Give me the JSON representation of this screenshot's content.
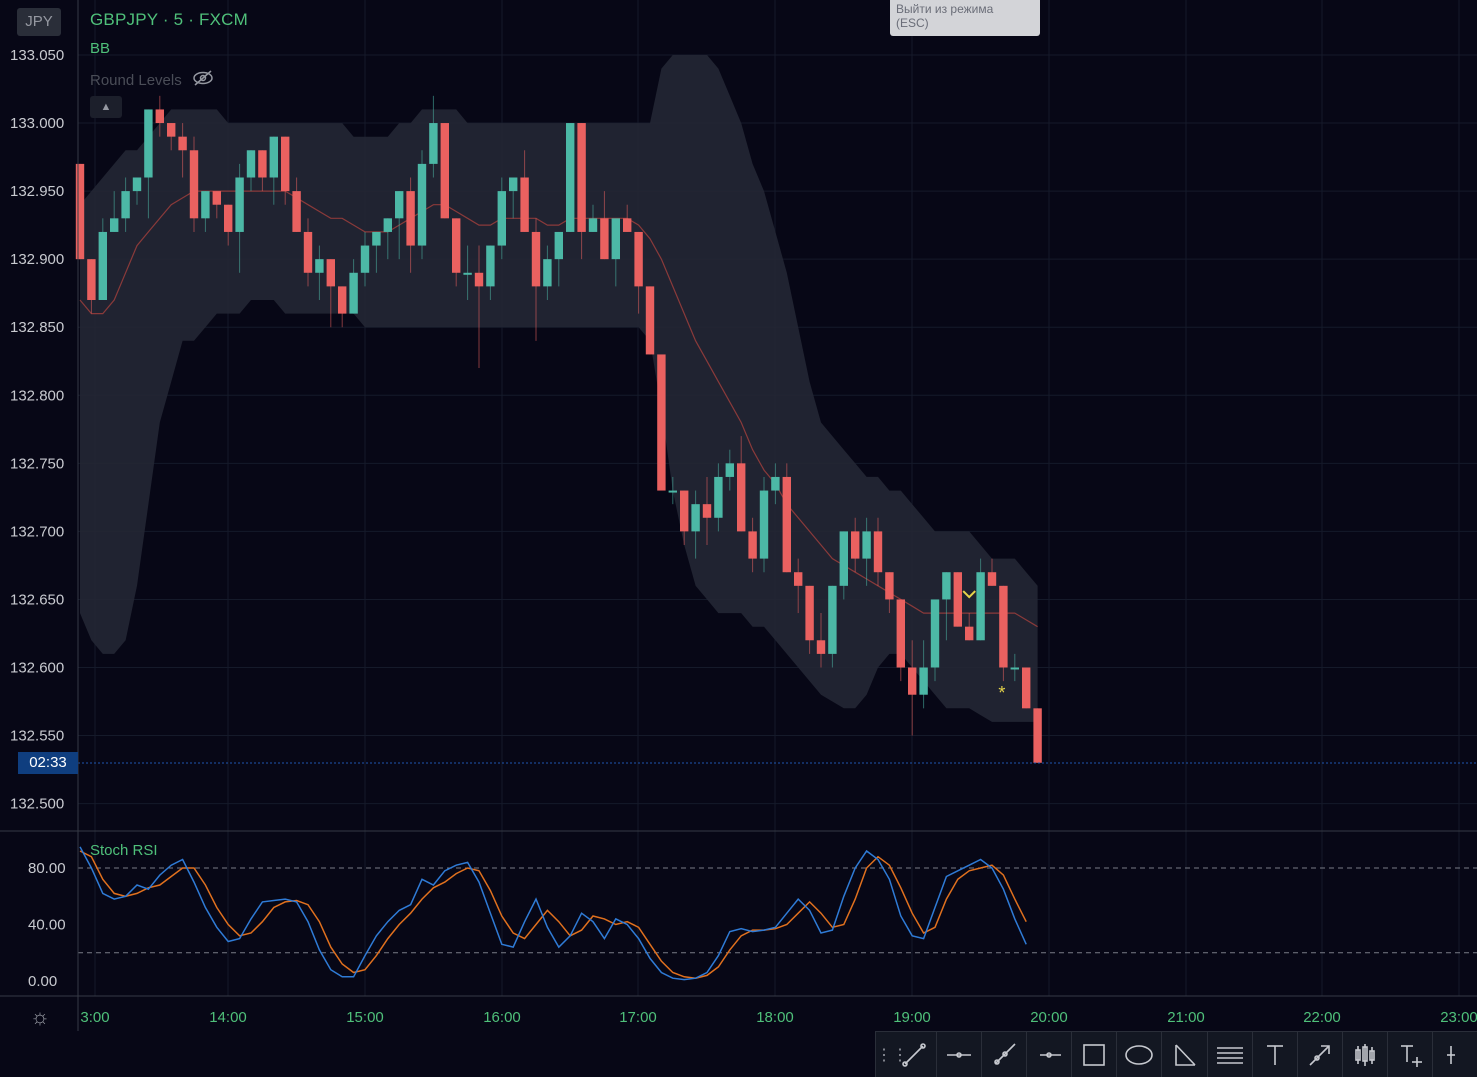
{
  "header": {
    "currency_badge": "JPY",
    "symbol_line": "GBPJPY · 5 · FXCM",
    "indicators": [
      "BB",
      "Round Levels"
    ],
    "hidden_indicator_icon": "eye-off-icon",
    "collapse_icon": "chevron-up-icon"
  },
  "tooltip": {
    "line1": "Выйти из режима",
    "line2": "(ESC)"
  },
  "countdown": "02:33",
  "price_axis": {
    "labels": [
      "133.050",
      "133.000",
      "132.950",
      "132.900",
      "132.850",
      "132.800",
      "132.750",
      "132.700",
      "132.650",
      "132.600",
      "132.550",
      "132.500"
    ]
  },
  "stoch_panel": {
    "title": "Stoch RSI",
    "axis_labels": [
      "80.00",
      "40.00",
      "0.00"
    ],
    "bands": [
      20,
      80
    ]
  },
  "time_axis": {
    "labels": [
      "3:00",
      "14:00",
      "15:00",
      "16:00",
      "17:00",
      "18:00",
      "19:00",
      "20:00",
      "21:00",
      "22:00",
      "23:00"
    ]
  },
  "colors": {
    "background": "#070716",
    "bull": "#4cb8a6",
    "bear": "#ea6160",
    "k_line": "#2f7bd6",
    "d_line": "#e0701e",
    "axis_text": "#4fc07a",
    "band_fill": "#232734"
  },
  "toolbar": {
    "icons": [
      "trend-line-icon",
      "horizontal-line-icon",
      "ray-icon",
      "horizontal-ray-icon",
      "rectangle-icon",
      "ellipse-icon",
      "angle-icon",
      "parallel-lines-icon",
      "text-icon",
      "arrow-icon",
      "candles-icon",
      "anchored-text-icon"
    ]
  },
  "chart_data": {
    "type": "candlestick",
    "symbol": "GBPJPY",
    "timeframe": "5",
    "source": "FXCM",
    "ylim": [
      132.48,
      133.08
    ],
    "candles": [
      [
        132.97,
        132.97,
        132.9,
        132.9
      ],
      [
        132.9,
        132.9,
        132.86,
        132.87
      ],
      [
        132.87,
        132.93,
        132.87,
        132.92
      ],
      [
        132.92,
        132.95,
        132.92,
        132.93
      ],
      [
        132.93,
        132.96,
        132.92,
        132.95
      ],
      [
        132.95,
        132.96,
        132.94,
        132.96
      ],
      [
        132.96,
        133.01,
        132.93,
        133.01
      ],
      [
        133.01,
        133.02,
        132.99,
        133.0
      ],
      [
        133.0,
        133.0,
        132.98,
        132.99
      ],
      [
        132.99,
        133.0,
        132.96,
        132.98
      ],
      [
        132.98,
        132.99,
        132.92,
        132.93
      ],
      [
        132.93,
        132.95,
        132.92,
        132.95
      ],
      [
        132.95,
        132.95,
        132.93,
        132.94
      ],
      [
        132.94,
        132.94,
        132.91,
        132.92
      ],
      [
        132.92,
        132.97,
        132.89,
        132.96
      ],
      [
        132.96,
        132.98,
        132.95,
        132.98
      ],
      [
        132.98,
        132.98,
        132.95,
        132.96
      ],
      [
        132.96,
        132.99,
        132.94,
        132.99
      ],
      [
        132.99,
        132.99,
        132.94,
        132.95
      ],
      [
        132.95,
        132.96,
        132.92,
        132.92
      ],
      [
        132.92,
        132.93,
        132.88,
        132.89
      ],
      [
        132.89,
        132.91,
        132.87,
        132.9
      ],
      [
        132.9,
        132.9,
        132.85,
        132.88
      ],
      [
        132.88,
        132.88,
        132.85,
        132.86
      ],
      [
        132.86,
        132.9,
        132.86,
        132.89
      ],
      [
        132.89,
        132.92,
        132.88,
        132.91
      ],
      [
        132.91,
        132.92,
        132.89,
        132.92
      ],
      [
        132.92,
        132.93,
        132.9,
        132.93
      ],
      [
        132.93,
        132.95,
        132.9,
        132.95
      ],
      [
        132.95,
        132.96,
        132.89,
        132.91
      ],
      [
        132.91,
        132.98,
        132.9,
        132.97
      ],
      [
        132.97,
        133.02,
        132.96,
        133.0
      ],
      [
        133.0,
        133.0,
        132.93,
        132.93
      ],
      [
        132.93,
        132.93,
        132.88,
        132.89
      ],
      [
        132.89,
        132.91,
        132.87,
        132.89
      ],
      [
        132.89,
        132.91,
        132.82,
        132.88
      ],
      [
        132.88,
        132.91,
        132.87,
        132.91
      ],
      [
        132.91,
        132.96,
        132.9,
        132.95
      ],
      [
        132.95,
        132.96,
        132.93,
        132.96
      ],
      [
        132.96,
        132.98,
        132.92,
        132.92
      ],
      [
        132.92,
        132.93,
        132.84,
        132.88
      ],
      [
        132.88,
        132.91,
        132.87,
        132.9
      ],
      [
        132.9,
        132.92,
        132.88,
        132.92
      ],
      [
        132.92,
        133.0,
        132.92,
        133.0
      ],
      [
        133.0,
        133.0,
        132.9,
        132.92
      ],
      [
        132.92,
        132.94,
        132.92,
        132.93
      ],
      [
        132.93,
        132.95,
        132.9,
        132.9
      ],
      [
        132.9,
        132.91,
        132.88,
        132.93
      ],
      [
        132.93,
        132.94,
        132.92,
        132.92
      ],
      [
        132.92,
        132.92,
        132.86,
        132.88
      ],
      [
        132.88,
        132.88,
        132.83,
        132.83
      ],
      [
        132.83,
        132.83,
        132.73,
        132.73
      ],
      [
        132.73,
        132.74,
        132.72,
        132.73
      ],
      [
        132.73,
        132.73,
        132.69,
        132.7
      ],
      [
        132.7,
        132.73,
        132.68,
        132.72
      ],
      [
        132.72,
        132.74,
        132.69,
        132.71
      ],
      [
        132.71,
        132.75,
        132.7,
        132.74
      ],
      [
        132.74,
        132.76,
        132.73,
        132.75
      ],
      [
        132.75,
        132.77,
        132.7,
        132.7
      ],
      [
        132.7,
        132.71,
        132.67,
        132.68
      ],
      [
        132.68,
        132.74,
        132.67,
        132.73
      ],
      [
        132.73,
        132.75,
        132.72,
        132.74
      ],
      [
        132.74,
        132.75,
        132.67,
        132.67
      ],
      [
        132.67,
        132.68,
        132.64,
        132.66
      ],
      [
        132.66,
        132.66,
        132.61,
        132.62
      ],
      [
        132.62,
        132.64,
        132.6,
        132.61
      ],
      [
        132.61,
        132.66,
        132.6,
        132.66
      ],
      [
        132.66,
        132.7,
        132.65,
        132.7
      ],
      [
        132.7,
        132.71,
        132.67,
        132.68
      ],
      [
        132.68,
        132.71,
        132.66,
        132.7
      ],
      [
        132.7,
        132.71,
        132.66,
        132.67
      ],
      [
        132.67,
        132.67,
        132.64,
        132.65
      ],
      [
        132.65,
        132.65,
        132.59,
        132.6
      ],
      [
        132.6,
        132.62,
        132.55,
        132.58
      ],
      [
        132.58,
        132.62,
        132.57,
        132.6
      ],
      [
        132.6,
        132.65,
        132.59,
        132.65
      ],
      [
        132.65,
        132.67,
        132.62,
        132.67
      ],
      [
        132.67,
        132.67,
        132.63,
        132.63
      ],
      [
        132.63,
        132.64,
        132.62,
        132.62
      ],
      [
        132.62,
        132.68,
        132.62,
        132.67
      ],
      [
        132.67,
        132.68,
        132.66,
        132.66
      ],
      [
        132.66,
        132.66,
        132.59,
        132.6
      ],
      [
        132.6,
        132.61,
        132.59,
        132.6
      ],
      [
        132.6,
        132.6,
        132.57,
        132.57
      ],
      [
        132.57,
        132.57,
        132.53,
        132.53
      ]
    ],
    "bollinger_mid": [
      132.87,
      132.86,
      132.86,
      132.87,
      132.89,
      132.91,
      132.92,
      132.93,
      132.94,
      132.945,
      132.95,
      132.95,
      132.95,
      132.95,
      132.95,
      132.95,
      132.95,
      132.95,
      132.95,
      132.945,
      132.94,
      132.935,
      132.93,
      132.93,
      132.925,
      132.92,
      132.92,
      132.92,
      132.925,
      132.93,
      132.935,
      132.94,
      132.94,
      132.935,
      132.93,
      132.925,
      132.925,
      132.93,
      132.93,
      132.93,
      132.93,
      132.925,
      132.925,
      132.93,
      132.93,
      132.93,
      132.93,
      132.93,
      132.93,
      132.925,
      132.915,
      132.9,
      132.88,
      132.86,
      132.84,
      132.825,
      132.81,
      132.795,
      132.78,
      132.76,
      132.745,
      132.735,
      132.72,
      132.71,
      132.7,
      132.69,
      132.68,
      132.675,
      132.67,
      132.665,
      132.66,
      132.655,
      132.65,
      132.645,
      132.64,
      132.64,
      132.64,
      132.64,
      132.64,
      132.64,
      132.64,
      132.64,
      132.64,
      132.635,
      132.63
    ],
    "bollinger_upper": [
      132.94,
      132.95,
      132.96,
      132.97,
      132.98,
      132.98,
      132.99,
      133.0,
      133.01,
      133.01,
      133.01,
      133.01,
      133.01,
      133.0,
      133.0,
      133.0,
      133.0,
      133.0,
      133.0,
      133.0,
      133.0,
      133.0,
      133.0,
      133.0,
      132.99,
      132.99,
      132.99,
      132.99,
      133.0,
      133.0,
      133.01,
      133.01,
      133.01,
      133.01,
      133.0,
      133.0,
      133.0,
      133.0,
      133.0,
      133.0,
      133.0,
      133.0,
      133.0,
      133.0,
      133.0,
      133.0,
      133.0,
      133.0,
      133.0,
      133.0,
      133.0,
      133.04,
      133.05,
      133.05,
      133.05,
      133.05,
      133.04,
      133.02,
      133.0,
      132.97,
      132.95,
      132.92,
      132.89,
      132.85,
      132.81,
      132.78,
      132.77,
      132.76,
      132.75,
      132.74,
      132.74,
      132.73,
      132.73,
      132.72,
      132.71,
      132.7,
      132.7,
      132.7,
      132.7,
      132.69,
      132.68,
      132.68,
      132.68,
      132.67,
      132.66
    ],
    "bollinger_lower": [
      132.64,
      132.62,
      132.61,
      132.61,
      132.62,
      132.66,
      132.72,
      132.78,
      132.81,
      132.84,
      132.84,
      132.85,
      132.86,
      132.86,
      132.86,
      132.87,
      132.87,
      132.87,
      132.86,
      132.86,
      132.86,
      132.86,
      132.86,
      132.86,
      132.86,
      132.85,
      132.85,
      132.85,
      132.85,
      132.85,
      132.85,
      132.85,
      132.85,
      132.85,
      132.85,
      132.85,
      132.85,
      132.85,
      132.85,
      132.85,
      132.85,
      132.85,
      132.85,
      132.85,
      132.85,
      132.85,
      132.85,
      132.85,
      132.85,
      132.85,
      132.84,
      132.79,
      132.73,
      132.69,
      132.66,
      132.65,
      132.64,
      132.64,
      132.64,
      132.63,
      132.63,
      132.62,
      132.61,
      132.6,
      132.59,
      132.58,
      132.575,
      132.57,
      132.57,
      132.58,
      132.6,
      132.61,
      132.61,
      132.6,
      132.59,
      132.58,
      132.57,
      132.57,
      132.57,
      132.565,
      132.56,
      132.56,
      132.56,
      132.56,
      132.56
    ],
    "markers": [
      {
        "index": 78,
        "symbol": "chevron-down",
        "color": "#e6d44a"
      },
      {
        "index": 81,
        "symbol": "*",
        "color": "#e6d44a"
      }
    ],
    "stoch_rsi": {
      "k": [
        95,
        80,
        62,
        58,
        60,
        68,
        65,
        75,
        82,
        86,
        70,
        52,
        38,
        28,
        30,
        44,
        56,
        57,
        58,
        56,
        42,
        22,
        8,
        3,
        3,
        18,
        32,
        42,
        50,
        54,
        72,
        68,
        78,
        82,
        84,
        70,
        48,
        26,
        24,
        42,
        58,
        38,
        24,
        32,
        48,
        42,
        30,
        44,
        40,
        30,
        16,
        6,
        2,
        1,
        2,
        6,
        18,
        35,
        37,
        35,
        36,
        38,
        48,
        58,
        50,
        34,
        36,
        60,
        80,
        92,
        86,
        72,
        46,
        32,
        30,
        52,
        74,
        78,
        82,
        86,
        80,
        65,
        44,
        26
      ],
      "d": [
        92,
        88,
        72,
        62,
        60,
        62,
        66,
        68,
        74,
        80,
        80,
        68,
        52,
        40,
        32,
        34,
        42,
        52,
        56,
        57,
        54,
        42,
        24,
        12,
        6,
        8,
        18,
        30,
        40,
        48,
        58,
        66,
        70,
        76,
        80,
        78,
        64,
        46,
        34,
        30,
        40,
        50,
        42,
        32,
        36,
        46,
        44,
        40,
        42,
        38,
        26,
        14,
        6,
        3,
        2,
        4,
        10,
        22,
        32,
        36,
        36,
        37,
        40,
        48,
        56,
        48,
        38,
        40,
        58,
        80,
        88,
        82,
        66,
        48,
        34,
        38,
        58,
        72,
        78,
        80,
        82,
        75,
        58,
        42
      ]
    },
    "xlabels": [
      "3:00",
      "14:00",
      "15:00",
      "16:00",
      "17:00",
      "18:00",
      "19:00",
      "20:00",
      "21:00",
      "22:00",
      "23:00"
    ]
  }
}
